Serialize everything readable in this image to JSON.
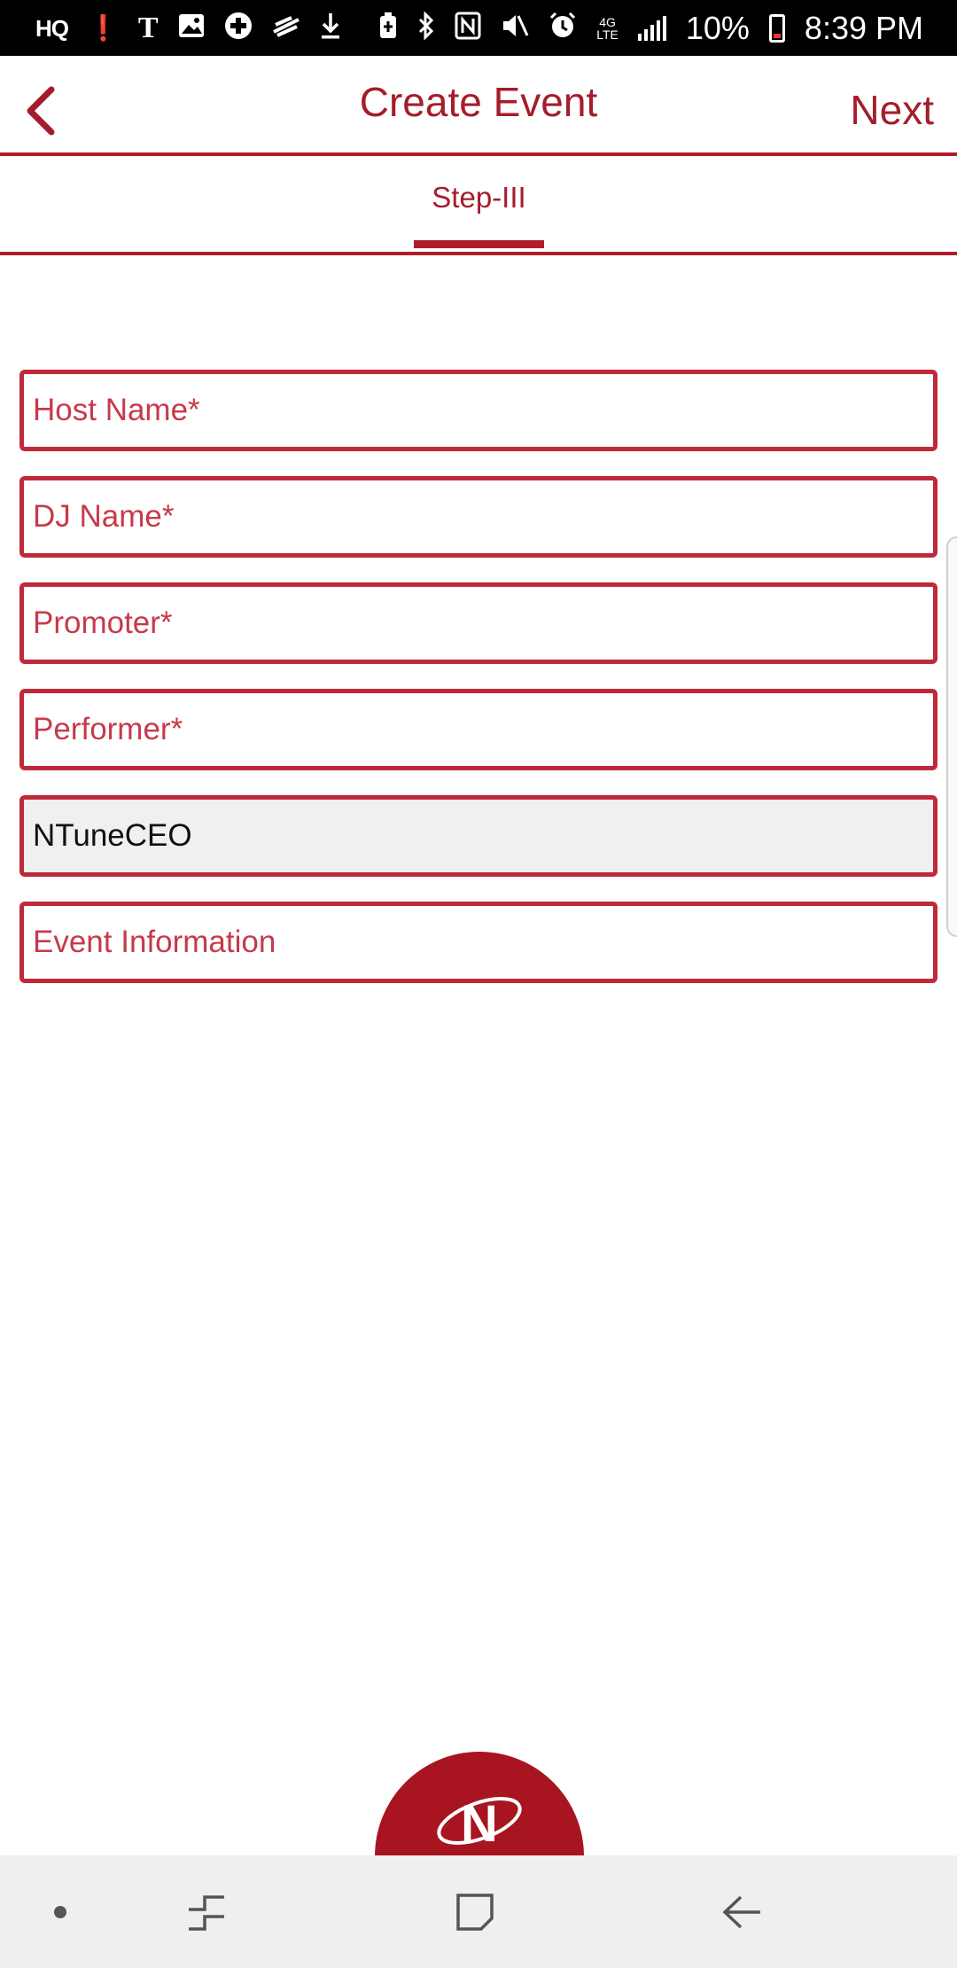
{
  "status_bar": {
    "left_icons": [
      "hq-icon",
      "alert-icon",
      "tmobile-icon",
      "image-icon",
      "plus-circle-icon",
      "zedge-icon",
      "download-icon"
    ],
    "hq_text": "HQ",
    "right_icons": [
      "battery-saver-icon",
      "bluetooth-icon",
      "nfc-icon",
      "mute-icon",
      "alarm-icon",
      "4g-lte-icon",
      "signal-icon",
      "battery-icon"
    ],
    "battery_percent": "10%",
    "time": "8:39 PM"
  },
  "header": {
    "title": "Create Event",
    "next_label": "Next"
  },
  "tabs": [
    {
      "label": "Step-III",
      "selected": true
    }
  ],
  "form": {
    "host_name": {
      "placeholder": "Host Name*",
      "value": ""
    },
    "dj_name": {
      "placeholder": "DJ Name*",
      "value": ""
    },
    "promoter": {
      "placeholder": "Promoter*",
      "value": ""
    },
    "performer": {
      "placeholder": "Performer*",
      "value": ""
    },
    "username": {
      "placeholder": "",
      "value": "NTuneCEO"
    },
    "event_information": {
      "placeholder": "Event Information",
      "value": ""
    }
  },
  "logo_text": "N",
  "colors": {
    "accent": "#a51d2c",
    "border": "#c0293a",
    "fab": "#a8141f",
    "status_bar": "#000000",
    "nav_bar": "#efefef"
  }
}
